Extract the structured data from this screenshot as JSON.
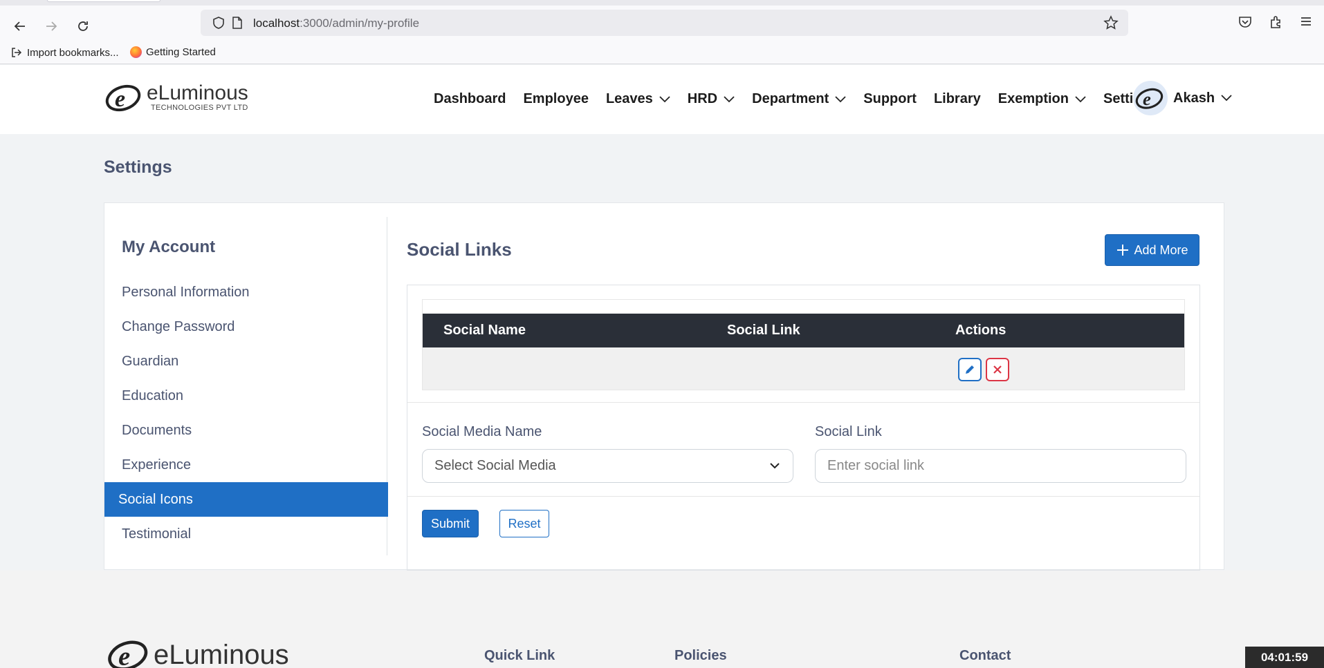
{
  "browser": {
    "url_host": "localhost",
    "url_path": ":3000/admin/my-profile",
    "bookmarks": [
      "Import bookmarks...",
      "Getting Started"
    ]
  },
  "header": {
    "logo_text": "eLuminous",
    "logo_sub": "TECHNOLOGIES PVT LTD",
    "nav": [
      {
        "label": "Dashboard",
        "dropdown": false
      },
      {
        "label": "Employee",
        "dropdown": false
      },
      {
        "label": "Leaves",
        "dropdown": true
      },
      {
        "label": "HRD",
        "dropdown": true
      },
      {
        "label": "Department",
        "dropdown": true
      },
      {
        "label": "Support",
        "dropdown": false
      },
      {
        "label": "Library",
        "dropdown": false
      },
      {
        "label": "Exemption",
        "dropdown": true
      },
      {
        "label": "Setting",
        "dropdown": true
      }
    ],
    "user_name": "Akash"
  },
  "page": {
    "title": "Settings"
  },
  "sidebar": {
    "heading": "My Account",
    "items": [
      {
        "label": "Personal Information",
        "active": false
      },
      {
        "label": "Change Password",
        "active": false
      },
      {
        "label": "Guardian",
        "active": false
      },
      {
        "label": "Education",
        "active": false
      },
      {
        "label": "Documents",
        "active": false
      },
      {
        "label": "Experience",
        "active": false
      },
      {
        "label": "Social Icons",
        "active": true
      },
      {
        "label": "Testimonial",
        "active": false
      }
    ]
  },
  "main": {
    "heading": "Social Links",
    "add_button": "Add More",
    "table": {
      "columns": [
        "Social Name",
        "Social Link",
        "Actions"
      ],
      "rows": [
        {
          "social_name": "",
          "social_link": ""
        }
      ]
    },
    "form": {
      "name_label": "Social Media Name",
      "name_select_value": "Select Social Media",
      "link_label": "Social Link",
      "link_placeholder": "Enter social link",
      "submit_label": "Submit",
      "reset_label": "Reset"
    }
  },
  "footer": {
    "logo_text": "eLuminous",
    "columns": [
      "Quick Link",
      "Policies",
      "Contact"
    ]
  },
  "clock": "04:01:59",
  "colors": {
    "primary": "#1f6fc5",
    "danger": "#dc3545",
    "table_head": "#2a2f38",
    "text_muted": "#4a5470"
  }
}
